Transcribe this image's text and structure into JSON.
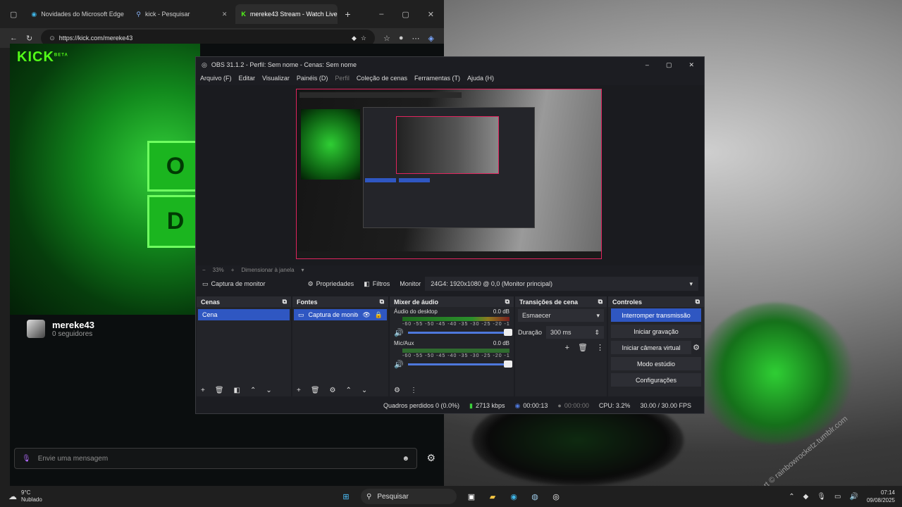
{
  "edge": {
    "tabs": [
      {
        "label": "Novidades do Microsoft Edge",
        "active": false
      },
      {
        "label": "kick - Pesquisar",
        "active": false
      },
      {
        "label": "mereke43 Stream - Watch Live",
        "active": true
      }
    ],
    "url": "https://kick.com/mereke43"
  },
  "kick": {
    "logo": "KICK",
    "logo_badge": "BETA",
    "channel_name": "mereke43",
    "followers": "0 seguidores",
    "chat_placeholder": "Envie uma mensagem",
    "video_text_1": "O",
    "video_text_2": "D"
  },
  "obs": {
    "title": "OBS 31.1.2 - Perfil: Sem nome - Cenas: Sem nome",
    "menu": [
      "Arquivo (F)",
      "Editar",
      "Visualizar",
      "Painéis (D)",
      "Perfil",
      "Coleção de cenas",
      "Ferramentas (T)",
      "Ajuda (H)"
    ],
    "zoom": "33%",
    "zoom_mode": "Dimensionar à janela",
    "source_toolbar": {
      "source_name": "Captura de monitor",
      "properties": "Propriedades",
      "filters": "Filtros",
      "monitor_label": "Monitor",
      "monitor_value": "24G4: 1920x1080 @ 0,0 (Monitor principal)"
    },
    "docks": {
      "scenes": {
        "title": "Cenas",
        "items": [
          "Cena"
        ]
      },
      "sources": {
        "title": "Fontes",
        "items": [
          "Captura de monitor"
        ]
      },
      "mixer": {
        "title": "Mixer de áudio",
        "scale": "-60 -55 -50 -45 -40 -35 -30 -25 -20 -15 -10 -5 0",
        "channels": [
          {
            "name": "Áudio do desktop",
            "db": "0.0 dB"
          },
          {
            "name": "Mic/Aux",
            "db": "0.0 dB"
          }
        ]
      },
      "transitions": {
        "title": "Transições de cena",
        "type": "Esmaecer",
        "duration_label": "Duração",
        "duration_value": "300 ms"
      },
      "controls": {
        "title": "Controles",
        "buttons": [
          "Interromper transmissão",
          "Iniciar gravação",
          "Iniciar câmera virtual",
          "Modo estúdio",
          "Configurações"
        ]
      }
    },
    "status": {
      "dropped": "Quadros perdidos 0 (0.0%)",
      "bitrate": "2713 kbps",
      "stream_time": "00:00:13",
      "rec_time": "00:00:00",
      "cpu": "CPU: 3.2%",
      "fps": "30.00 / 30.00 FPS"
    }
  },
  "taskbar": {
    "weather_temp": "9°C",
    "weather_desc": "Nublado",
    "search": "Pesquisar",
    "time": "07:14",
    "date": "09/08/2025"
  },
  "wallpaper": {
    "credit": "art © rainbowrocketz.tumblr.com"
  },
  "colors": {
    "kick_green": "#53fc18",
    "obs_accent": "#2f57c2",
    "preview_border": "#e0245e"
  }
}
